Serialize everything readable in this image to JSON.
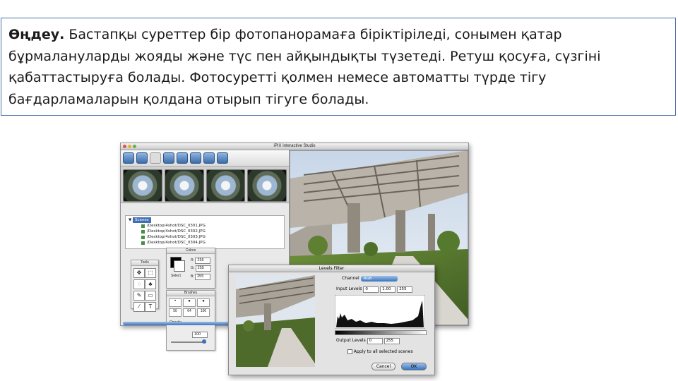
{
  "text": {
    "lead": "Өңдеу.",
    "body": " Бастапқы суреттер бір фотопанорамаға біріктіріледі, сонымен қатар бұрмалануларды жояды және түс пен айқындықты түзетеді. Ретуш қосуға, сүзгіні қабаттастыруға болады. Фотосуретті қолмен немесе автоматты түрде тігу бағдарламаларын қолдана отырып тігуге болады."
  },
  "app": {
    "title": "iPIX Interactive Studio",
    "tree": {
      "root": "Scenes",
      "files": [
        "/Desktop/4shot/DSC_0301.JPG",
        "/Desktop/4shot/DSC_0302.JPG",
        "/Desktop/4shot/DSC_0303.JPG",
        "/Desktop/4shot/DSC_0304.JPG"
      ]
    },
    "tools_title": "Tools",
    "colors_title": "Colors",
    "colors": {
      "r": "255",
      "g": "255",
      "b": "255",
      "select": "Select"
    },
    "brushes_title": "Brushes",
    "brush_sizes": [
      "50",
      "64",
      "100"
    ],
    "opacity_label": "Opacity",
    "opacity_value": "100"
  },
  "dialog": {
    "title": "Levels Filter",
    "channel_label": "Channel",
    "channel_value": "RGB",
    "input_label": "Input Levels",
    "input": [
      "0",
      "1.00",
      "255"
    ],
    "output_label": "Output Levels",
    "output": [
      "0",
      "255"
    ],
    "apply_all": "Apply to all selected scenes",
    "cancel": "Cancel",
    "ok": "OK"
  },
  "colors": {
    "border": "#4a6fa5",
    "aqua": "#3b73bd"
  }
}
